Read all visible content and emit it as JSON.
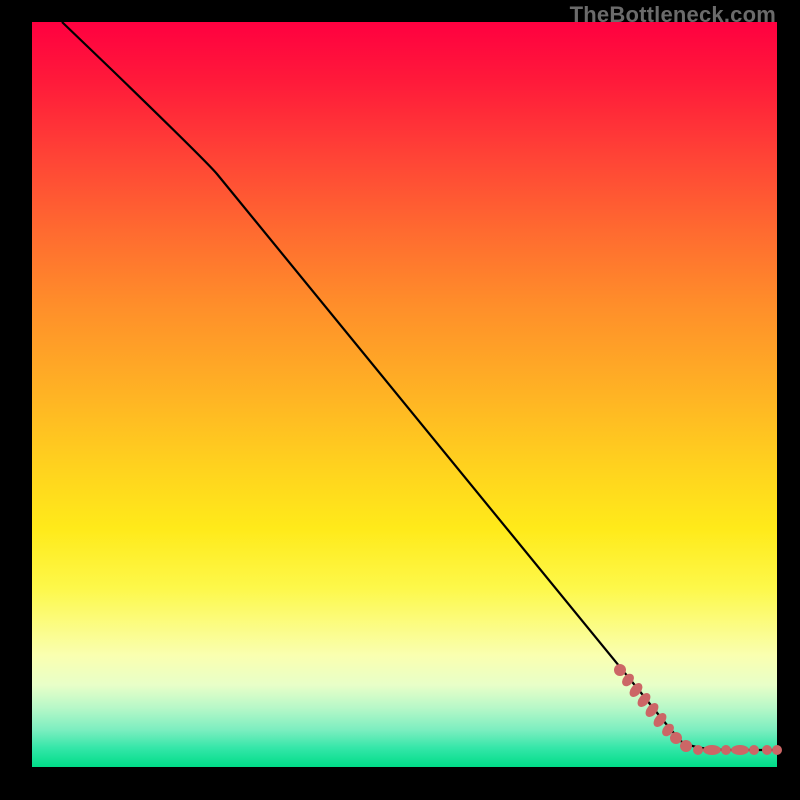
{
  "watermark": "TheBottleneck.com",
  "chart_data": {
    "type": "line",
    "title": "",
    "xlabel": "",
    "ylabel": "",
    "xlim": [
      0,
      100
    ],
    "ylim": [
      0,
      100
    ],
    "series": [
      {
        "name": "curve",
        "style": "solid-black",
        "points": [
          {
            "x": 4,
            "y": 100
          },
          {
            "x": 24,
            "y": 80
          },
          {
            "x": 82,
            "y": 9
          },
          {
            "x": 86,
            "y": 3
          },
          {
            "x": 100,
            "y": 3
          }
        ]
      },
      {
        "name": "dotted-tail",
        "style": "dotted-salmon",
        "points": [
          {
            "x": 79,
            "y": 13
          },
          {
            "x": 80,
            "y": 12
          },
          {
            "x": 81,
            "y": 10.5
          },
          {
            "x": 82,
            "y": 9
          },
          {
            "x": 83,
            "y": 7.5
          },
          {
            "x": 84,
            "y": 6
          },
          {
            "x": 85,
            "y": 4.5
          },
          {
            "x": 86,
            "y": 3
          },
          {
            "x": 88,
            "y": 3
          },
          {
            "x": 90,
            "y": 3
          },
          {
            "x": 92,
            "y": 3
          },
          {
            "x": 94,
            "y": 3
          },
          {
            "x": 96,
            "y": 3
          },
          {
            "x": 98,
            "y": 3
          },
          {
            "x": 100,
            "y": 3
          }
        ]
      }
    ],
    "colors": {
      "curve": "#000000",
      "dots": "#cc6666"
    }
  }
}
